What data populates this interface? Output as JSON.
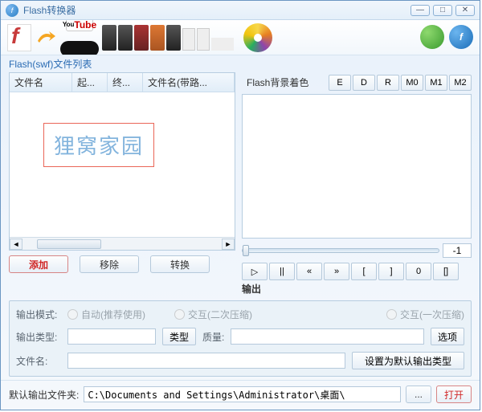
{
  "title": "Flash转换器",
  "winbtns": {
    "min": "—",
    "max": "□",
    "close": "✕"
  },
  "list_label": "Flash(swf)文件列表",
  "columns": {
    "c1": "文件名",
    "c2": "起...",
    "c3": "终...",
    "c4": "文件名(带路..."
  },
  "watermark": "狸窝家园",
  "left_buttons": {
    "add": "添加",
    "remove": "移除",
    "convert": "转换"
  },
  "preview": {
    "label": "Flash背景着色",
    "btns": {
      "e": "E",
      "d": "D",
      "r": "R",
      "m0": "M0",
      "m1": "M1",
      "m2": "M2"
    },
    "pos": "-1",
    "play": {
      "b1": "▷",
      "b2": "||",
      "b3": "«",
      "b4": "»",
      "b5": "[",
      "b6": "]",
      "b7": "0",
      "b8": "[]"
    }
  },
  "output_label": "输出",
  "form": {
    "mode_label": "输出模式:",
    "mode1": "自动(推荐使用)",
    "mode2": "交互(二次压缩)",
    "mode3": "交互(一次压缩)",
    "type_label": "输出类型:",
    "type_btn": "类型",
    "quality_label": "质量:",
    "options_btn": "选项",
    "filename_label": "文件名:",
    "setdefault_btn": "设置为默认输出类型"
  },
  "footer": {
    "label": "默认输出文件夹:",
    "path": "C:\\Documents and Settings\\Administrator\\桌面\\",
    "browse": "...",
    "open": "打开"
  }
}
